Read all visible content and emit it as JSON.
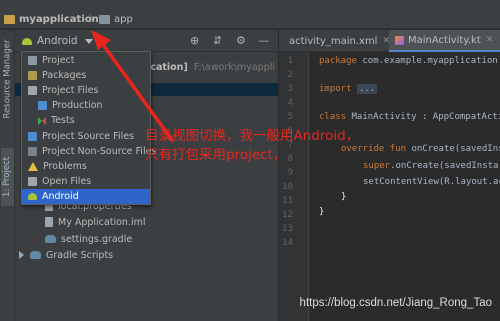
{
  "navbar": {
    "project_name": "myapplication",
    "module_name": "app"
  },
  "left_tool_tabs": {
    "resource_manager": "Resource Manager",
    "project": "1: Project"
  },
  "project_panel": {
    "view_selector": "Android",
    "header_partial_text": "plication]",
    "header_path_hint": "F:\\awork\\myappli",
    "tree": [
      {
        "label": "local.properties",
        "icon": "file-icon"
      },
      {
        "label": "My Application.iml",
        "icon": "file-icon"
      },
      {
        "label": "settings.gradle",
        "icon": "gradle-icon"
      },
      {
        "label": "Gradle Scripts",
        "icon": "gradle-icon"
      }
    ]
  },
  "view_menu": {
    "items": [
      {
        "label": "Project",
        "icon": "project-icon",
        "indent": false,
        "selected": false
      },
      {
        "label": "Packages",
        "icon": "package-icon",
        "indent": false,
        "selected": false
      },
      {
        "label": "Project Files",
        "icon": "folder-icon",
        "indent": false,
        "selected": false
      },
      {
        "label": "Production",
        "icon": "production-icon",
        "indent": true,
        "selected": false
      },
      {
        "label": "Tests",
        "icon": "tests-icon",
        "indent": true,
        "selected": false
      },
      {
        "label": "Project Source Files",
        "icon": "source-files-icon",
        "indent": false,
        "selected": false
      },
      {
        "label": "Project Non-Source Files",
        "icon": "non-source-files-icon",
        "indent": false,
        "selected": false
      },
      {
        "label": "Problems",
        "icon": "warning-icon",
        "indent": false,
        "selected": false
      },
      {
        "label": "Open Files",
        "icon": "open-files-icon",
        "indent": false,
        "selected": false
      },
      {
        "label": "Android",
        "icon": "android-icon",
        "indent": false,
        "selected": true
      }
    ]
  },
  "editor": {
    "tabs": [
      {
        "label": "activity_main.xml",
        "icon": "xml-file-icon",
        "active": false
      },
      {
        "label": "MainActivity.kt",
        "icon": "kotlin-file-icon",
        "active": true
      }
    ],
    "line_numbers": [
      "1",
      "2",
      "3",
      "4",
      "5",
      "6",
      "7",
      "8",
      "9",
      "10",
      "11",
      "12",
      "13",
      "14"
    ],
    "code": {
      "l1_kw": "package",
      "l1_rest": " com.example.myapplication",
      "l3_kw": "import",
      "l3_fold": "...",
      "l5_kw": "class",
      "l5_rest": " MainActivity : AppCompatActi",
      "l6_kw": "override fun",
      "l6_rest": " onCreate(savedIns",
      "l7_kw": "super",
      "l7_rest": ".onCreate(savedInsta",
      "l8_text": "setContentView(R.layout.ac",
      "l9_text": "}",
      "l10_text": "}"
    }
  },
  "annotation": {
    "line1": "目录视图切换，我一般用Android，",
    "line2": "只有打包采用project，"
  },
  "watermark": "https://blog.csdn.net/Jiang_Rong_Tao",
  "colors": {
    "accent": "#2f65ca",
    "annotation": "#e8261c",
    "keyword": "#cc7832"
  }
}
